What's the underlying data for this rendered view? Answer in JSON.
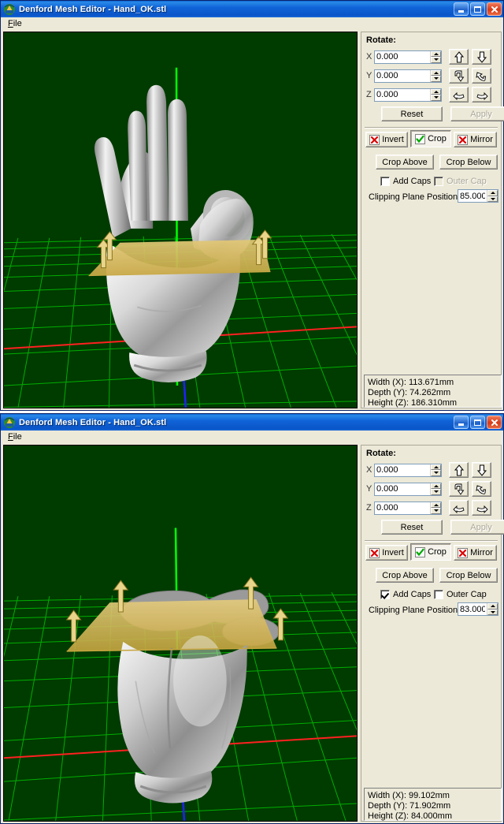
{
  "app": {
    "title": "Denford Mesh Editor - Hand_OK.stl",
    "icon": "app-icon",
    "menu": [
      {
        "label": "File",
        "accel": "F"
      }
    ],
    "titlebar_buttons": {
      "minimize": "Minimize",
      "maximize": "Maximize",
      "close": "Close"
    }
  },
  "colors": {
    "titlebar_blue": "#0a55c8",
    "viewport_bg": "#003b00",
    "grid_line": "#00b400",
    "axis_x": "#ff0000",
    "axis_y": "#00ff00",
    "axis_z": "#0000ff",
    "clip_plane": "#d4b45a",
    "mesh": "#c8c8c8",
    "cap": "#969696",
    "panel_bg": "#ece9d8"
  },
  "windows": [
    {
      "id": "window-top",
      "title": "Denford Mesh Editor - Hand_OK.stl",
      "panel": {
        "rotate_group_label": "Rotate:",
        "rotate_axes": [
          {
            "axis": "X",
            "value": "0.000",
            "placeholder": "0.000"
          },
          {
            "axis": "Y",
            "value": "0.000",
            "placeholder": "0.000"
          },
          {
            "axis": "Z",
            "value": "0.000",
            "placeholder": "0.000"
          }
        ],
        "rotate_buttons": [
          {
            "name": "rotate-x-up-icon",
            "label": "Rotate X up"
          },
          {
            "name": "rotate-x-down-icon",
            "label": "Rotate X down"
          },
          {
            "name": "rotate-y-cw-icon",
            "label": "Rotate Y clockwise"
          },
          {
            "name": "rotate-y-ccw-icon",
            "label": "Rotate Y counter-clockwise"
          },
          {
            "name": "rotate-z-left-icon",
            "label": "Rotate Z left"
          },
          {
            "name": "rotate-z-right-icon",
            "label": "Rotate Z right"
          }
        ],
        "reset_label": "Reset",
        "apply_label": "Apply",
        "apply_enabled": false,
        "modes": [
          {
            "label": "Invert",
            "icon": "red-x-icon",
            "active": false
          },
          {
            "label": "Crop",
            "icon": "green-check-icon",
            "active": true
          },
          {
            "label": "Mirror",
            "icon": "red-x-icon",
            "active": false
          }
        ],
        "crop_above_label": "Crop Above",
        "crop_below_label": "Crop Below",
        "add_caps": {
          "label": "Add Caps",
          "checked": false,
          "enabled": true
        },
        "outer_cap": {
          "label": "Outer Cap",
          "checked": false,
          "enabled": false
        },
        "clipping_plane_label": "Clipping Plane Position",
        "clipping_plane_value": "85.000"
      },
      "status": {
        "width": "Width (X): 113.671mm",
        "depth": "Depth (Y): 74.262mm",
        "height": "Height (Z): 186.310mm"
      },
      "viewport": {
        "model": "open-hand-mesh",
        "plane_visible": true,
        "caps_visible": false
      }
    },
    {
      "id": "window-bottom",
      "title": "Denford Mesh Editor - Hand_OK.stl",
      "panel": {
        "rotate_group_label": "Rotate:",
        "rotate_axes": [
          {
            "axis": "X",
            "value": "0.000",
            "placeholder": "0.000"
          },
          {
            "axis": "Y",
            "value": "0.000",
            "placeholder": "0.000"
          },
          {
            "axis": "Z",
            "value": "0.000",
            "placeholder": "0.000"
          }
        ],
        "rotate_buttons": [
          {
            "name": "rotate-x-up-icon",
            "label": "Rotate X up"
          },
          {
            "name": "rotate-x-down-icon",
            "label": "Rotate X down"
          },
          {
            "name": "rotate-y-cw-icon",
            "label": "Rotate Y clockwise"
          },
          {
            "name": "rotate-y-ccw-icon",
            "label": "Rotate Y counter-clockwise"
          },
          {
            "name": "rotate-z-left-icon",
            "label": "Rotate Z left"
          },
          {
            "name": "rotate-z-right-icon",
            "label": "Rotate Z right"
          }
        ],
        "reset_label": "Reset",
        "apply_label": "Apply",
        "apply_enabled": false,
        "modes": [
          {
            "label": "Invert",
            "icon": "red-x-icon",
            "active": false
          },
          {
            "label": "Crop",
            "icon": "green-check-icon",
            "active": true
          },
          {
            "label": "Mirror",
            "icon": "red-x-icon",
            "active": false
          }
        ],
        "crop_above_label": "Crop Above",
        "crop_below_label": "Crop Below",
        "add_caps": {
          "label": "Add Caps",
          "checked": true,
          "enabled": true
        },
        "outer_cap": {
          "label": "Outer Cap",
          "checked": false,
          "enabled": true
        },
        "clipping_plane_label": "Clipping Plane Position",
        "clipping_plane_value": "83.000"
      },
      "status": {
        "width": "Width (X): 99.102mm",
        "depth": "Depth (Y): 71.902mm",
        "height": "Height (Z): 84.000mm"
      },
      "viewport": {
        "model": "cropped-hand-mesh",
        "plane_visible": true,
        "caps_visible": true
      }
    }
  ]
}
